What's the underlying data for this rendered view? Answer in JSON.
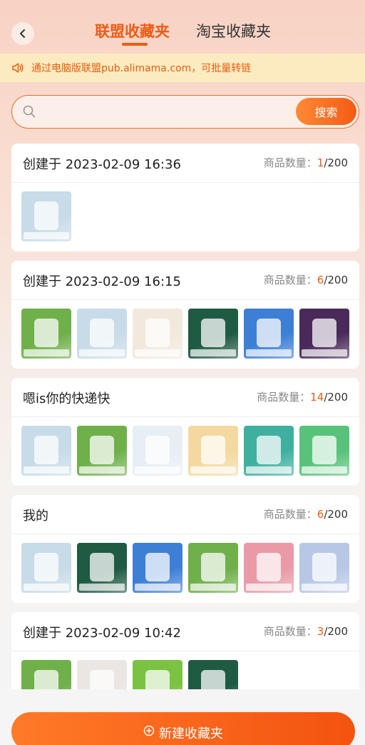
{
  "header": {
    "tabs": [
      {
        "label": "联盟收藏夹",
        "active": true
      },
      {
        "label": "淘宝收藏夹",
        "active": false
      }
    ]
  },
  "notice": {
    "text": "通过电脑版联盟pub.alimama.com，可批量转链"
  },
  "search": {
    "placeholder": "",
    "value": "",
    "button_label": "搜索"
  },
  "folders": [
    {
      "title": "创建于 2023-02-09 16:36",
      "count_label": "商品数量：",
      "count": "1",
      "total": "/200",
      "thumbs": [
        "#c7dbe8"
      ]
    },
    {
      "title": "创建于 2023-02-09 16:15",
      "count_label": "商品数量：",
      "count": "6",
      "total": "/200",
      "thumbs": [
        "#6fb04a",
        "#c7dbe8",
        "#f2e9dc",
        "#1f5a43",
        "#3e7fd6",
        "#4a2a5a"
      ]
    },
    {
      "title": "嗯is你的快递快",
      "count_label": "商品数量：",
      "count": "14",
      "total": "/200",
      "thumbs": [
        "#c7dbe8",
        "#6fb04a",
        "#e7eef4",
        "#f3d9a0",
        "#3fb0a0",
        "#58c27a"
      ]
    },
    {
      "title": "我的",
      "count_label": "商品数量：",
      "count": "6",
      "total": "/200",
      "thumbs": [
        "#c7dbe8",
        "#1f5a43",
        "#3e7fd6",
        "#6fb04a",
        "#e99aa6",
        "#b8c7e6"
      ]
    },
    {
      "title": "创建于 2023-02-09 10:42",
      "count_label": "商品数量：",
      "count": "3",
      "total": "/200",
      "thumbs": [
        "#6fb04a",
        "#ece6e2",
        "#7cc242",
        "#1f5a43"
      ]
    }
  ],
  "new_folder_button": {
    "label": "新建收藏夹"
  },
  "colors": {
    "accent": "#f05a14",
    "notice_bg": "#fcebc0"
  }
}
